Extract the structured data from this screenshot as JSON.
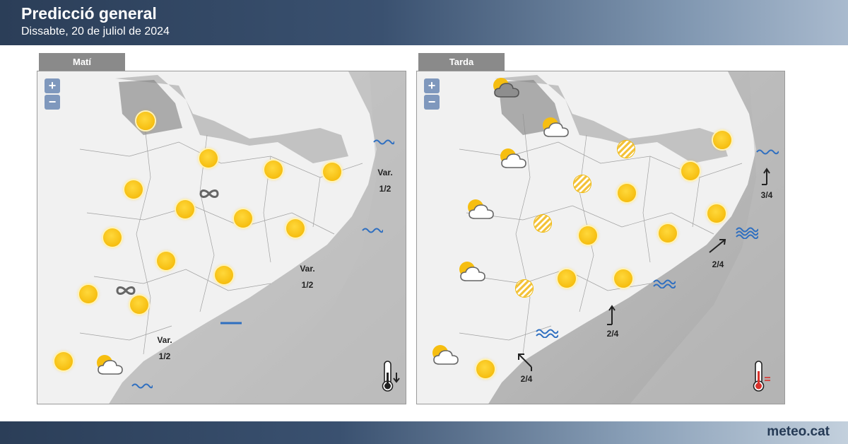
{
  "header": {
    "title": "Predicció general",
    "subtitle": "Dissabte, 20 de juliol de 2024"
  },
  "panels": [
    {
      "tab": "Matí",
      "zoom_in": "+",
      "zoom_out": "−",
      "labels": [
        {
          "id": "m-var1",
          "text": "Var."
        },
        {
          "id": "m-val1",
          "text": "1/2"
        },
        {
          "id": "m-var2",
          "text": "Var."
        },
        {
          "id": "m-val2",
          "text": "1/2"
        },
        {
          "id": "m-var3",
          "text": "Var."
        },
        {
          "id": "m-val3",
          "text": "1/2"
        }
      ],
      "thermometer": "temperature-falling"
    },
    {
      "tab": "Tarda",
      "zoom_in": "+",
      "zoom_out": "−",
      "labels": [
        {
          "id": "t-w1",
          "text": "3/4"
        },
        {
          "id": "t-w2",
          "text": "2/4"
        },
        {
          "id": "t-w3",
          "text": "2/4"
        },
        {
          "id": "t-w4",
          "text": "2/4"
        }
      ],
      "thermometer": "temperature-stable"
    }
  ],
  "footer": {
    "brand": "meteo.cat"
  },
  "colors": {
    "header_dark": "#2b3e58",
    "sun": "#f6be10",
    "sea_symbol": "#2f6fc0",
    "zoom_button": "#7f98bd"
  }
}
